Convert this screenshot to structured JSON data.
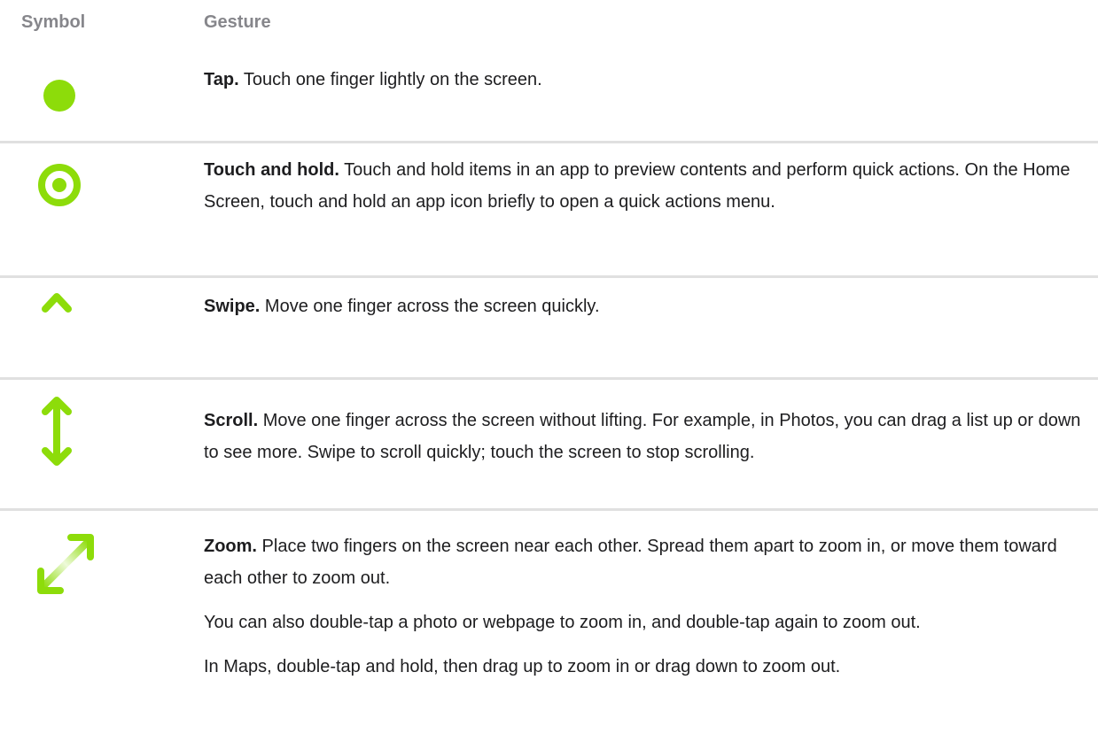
{
  "header": {
    "symbol": "Symbol",
    "gesture": "Gesture"
  },
  "colors": {
    "accent": "#8ddc0a",
    "divider": "#e0e0e0",
    "header_text": "#86868b",
    "body_text": "#1d1d1f"
  },
  "rows": [
    {
      "icon": "tap-dot-icon",
      "title": "Tap.",
      "paragraphs": [
        " Touch one finger lightly on the screen."
      ]
    },
    {
      "icon": "touch-and-hold-ring-icon",
      "title": "Touch and hold.",
      "paragraphs": [
        " Touch and hold items in an app to preview contents and perform quick actions. On the Home Screen, touch and hold an app icon briefly to open a quick actions menu."
      ]
    },
    {
      "icon": "swipe-up-arrow-icon",
      "title": "Swipe.",
      "paragraphs": [
        " Move one finger across the screen quickly."
      ]
    },
    {
      "icon": "scroll-double-arrow-icon",
      "title": "Scroll.",
      "paragraphs": [
        " Move one finger across the screen without lifting. For example, in Photos, you can drag a list up or down to see more. Swipe to scroll quickly; touch the screen to stop scrolling."
      ]
    },
    {
      "icon": "zoom-diagonal-arrows-icon",
      "title": "Zoom.",
      "paragraphs": [
        " Place two fingers on the screen near each other. Spread them apart to zoom in, or move them toward each other to zoom out.",
        "You can also double-tap a photo or webpage to zoom in, and double-tap again to zoom out.",
        "In Maps, double-tap and hold, then drag up to zoom in or drag down to zoom out."
      ]
    }
  ]
}
